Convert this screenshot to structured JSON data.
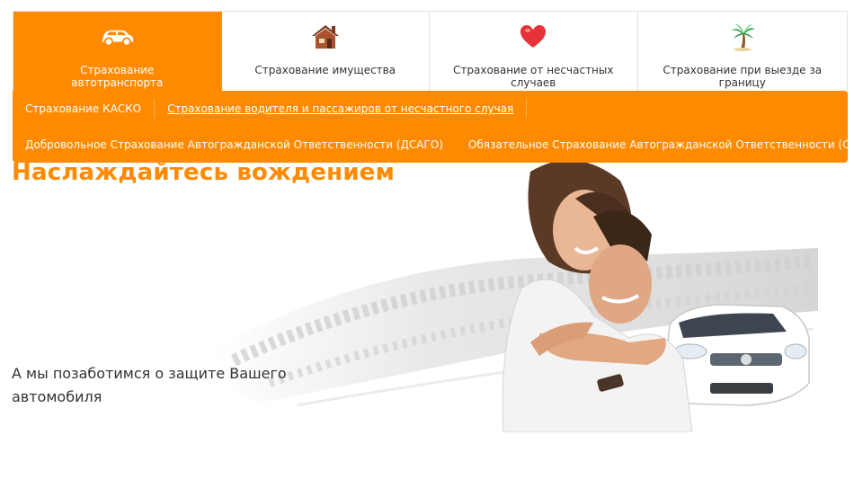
{
  "tabs": [
    {
      "label": "Страхование автотранспорта",
      "icon": "car-icon",
      "active": true
    },
    {
      "label": "Страхование имущества",
      "icon": "house-icon",
      "active": false
    },
    {
      "label": "Страхование от несчастных случаев",
      "icon": "heart-icon",
      "active": false
    },
    {
      "label": "Страхование при выезде за границу",
      "icon": "palm-tree-icon",
      "active": false
    }
  ],
  "submenu": {
    "row1": [
      {
        "label": "Страхование КАСКО",
        "active": false
      },
      {
        "label": "Страхование водителя и пассажиров от несчастного случая",
        "active": true
      }
    ],
    "row2": [
      {
        "label": "Добровольное Страхование Автогражданской Ответственности (ДСАГО)",
        "active": false
      },
      {
        "label": "Обязательное Страхование Автогражданской Ответственности (ОСАГО)",
        "active": false
      }
    ]
  },
  "hero": {
    "headline": "Наслаждайтесь вождением",
    "subline": "А мы позаботимся о защите Вашего автомобиля"
  },
  "colors": {
    "accent": "#ff8a00",
    "heart": "#e8323a",
    "house": "#9b4a2c",
    "palm": "#2ea84a"
  }
}
